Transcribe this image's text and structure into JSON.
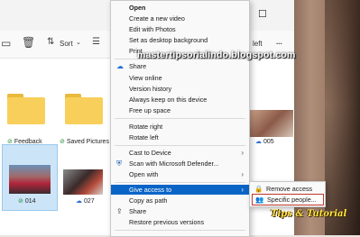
{
  "toolbar": {
    "delete_icon": "trash-icon",
    "sort_label": "Sort",
    "view_icon": "view-icon",
    "partial_label": "left",
    "more_label": "..."
  },
  "window": {
    "minimize_glyph": "—",
    "maximize_glyph": "☐"
  },
  "files": [
    {
      "name": "Feedback",
      "type": "folder",
      "sync": "ok"
    },
    {
      "name": "Saved Pictures",
      "type": "folder",
      "sync": "ok"
    },
    {
      "name": "005",
      "type": "image",
      "sync": "cloud"
    },
    {
      "name": "014",
      "type": "image",
      "sync": "ok",
      "selected": true
    },
    {
      "name": "027",
      "type": "image",
      "sync": "cloud"
    }
  ],
  "context_menu": {
    "items": [
      {
        "label": "Open",
        "bold": true
      },
      {
        "label": "Create a new video"
      },
      {
        "label": "Edit with Photos"
      },
      {
        "label": "Set as desktop background"
      },
      {
        "label": "Print"
      },
      {
        "label": "Share",
        "icon": "onedrive-cloud-icon"
      },
      {
        "label": "View online"
      },
      {
        "label": "Version history"
      },
      {
        "label": "Always keep on this device"
      },
      {
        "label": "Free up space"
      },
      {
        "label": "Rotate right"
      },
      {
        "label": "Rotate left"
      },
      {
        "label": "Cast to Device",
        "submenu": true
      },
      {
        "label": "Scan with Microsoft Defender...",
        "icon": "defender-shield-icon"
      },
      {
        "label": "Open with",
        "submenu": true
      },
      {
        "label": "Give access to",
        "submenu": true,
        "highlighted": true
      },
      {
        "label": "Copy as path"
      },
      {
        "label": "Share",
        "icon": "share-icon"
      },
      {
        "label": "Restore previous versions"
      }
    ]
  },
  "submenu": {
    "items": [
      {
        "label": "Remove access",
        "icon": "lock-icon"
      },
      {
        "label": "Specific people...",
        "icon": "people-icon"
      }
    ]
  },
  "watermark": {
    "url": "mastertipsorialindo.blogspot.com",
    "badge": "Tips & Tutorial"
  },
  "colors": {
    "highlight": "#0a64c6",
    "folder": "#f8cf5a",
    "selection": "#cce4f7",
    "callout_border": "#c0392b"
  }
}
